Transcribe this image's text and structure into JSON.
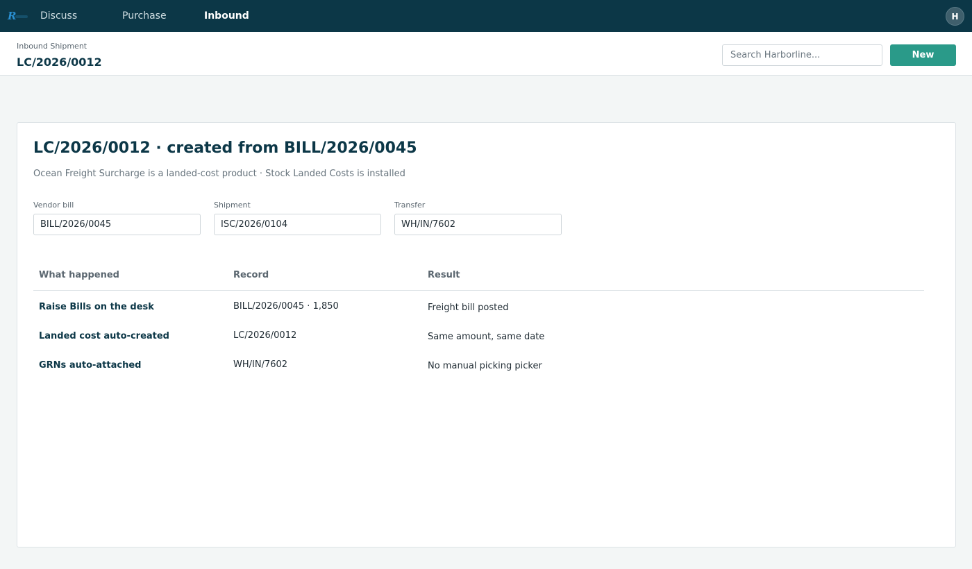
{
  "nav": {
    "items": [
      {
        "label": "Discuss",
        "active": false
      },
      {
        "label": "Purchase",
        "active": false
      },
      {
        "label": "Inbound",
        "active": true
      }
    ],
    "avatar_initial": "H"
  },
  "control": {
    "breadcrumb": "Inbound Shipment",
    "title": "LC/2026/0012",
    "search_placeholder": "Search Harborline...",
    "new_label": "New"
  },
  "card": {
    "title": "LC/2026/0012  ·  created from BILL/2026/0045",
    "subtitle": "Ocean Freight Surcharge is a landed-cost product  ·  Stock Landed Costs is installed",
    "fields": [
      {
        "label": "Vendor bill",
        "value": "BILL/2026/0045"
      },
      {
        "label": "Shipment",
        "value": "ISC/2026/0104"
      },
      {
        "label": "Transfer",
        "value": "WH/IN/7602"
      }
    ],
    "table": {
      "headers": [
        "What happened",
        "Record",
        "Result"
      ],
      "rows": [
        {
          "what": "Raise Bills on the desk",
          "record": "BILL/2026/0045  ·  1,850",
          "result": "Freight bill posted"
        },
        {
          "what": "Landed cost auto-created",
          "record": "LC/2026/0012",
          "result": "Same amount, same date"
        },
        {
          "what": "GRNs auto-attached",
          "record": "WH/IN/7602",
          "result": "No manual picking picker"
        }
      ]
    }
  },
  "colors": {
    "topbar": "#0c3747",
    "accent": "#2a9a89",
    "page_bg": "#f3f6f6"
  }
}
